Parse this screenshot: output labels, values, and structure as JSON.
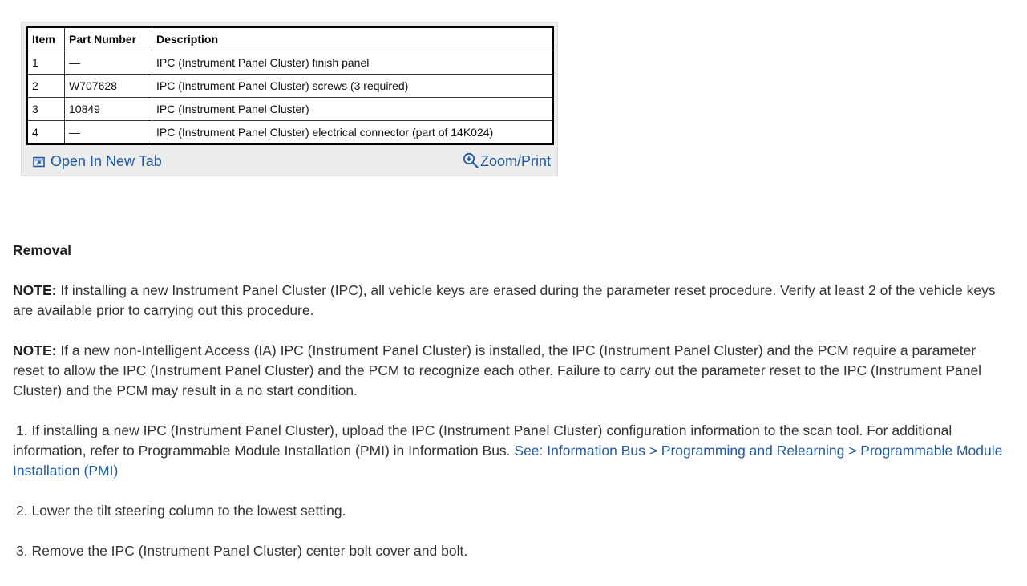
{
  "parts_table": {
    "headers": [
      "Item",
      "Part Number",
      "Description"
    ],
    "rows": [
      [
        "1",
        "—",
        "IPC (Instrument Panel Cluster) finish panel"
      ],
      [
        "2",
        "W707628",
        "IPC (Instrument Panel Cluster) screws (3 required)"
      ],
      [
        "3",
        "10849",
        "IPC (Instrument Panel Cluster)"
      ],
      [
        "4",
        "—",
        "IPC (Instrument Panel Cluster) electrical connector (part of 14K024)"
      ]
    ]
  },
  "figure_links": {
    "open_new_tab": "Open In New Tab",
    "open_new_tab_icon": "open-in-new-tab-icon",
    "zoom_print": "Zoom/Print",
    "zoom_print_icon": "zoom-in-icon"
  },
  "section": {
    "title": "Removal",
    "notes": [
      {
        "label": "NOTE:",
        "text": " If installing a new Instrument Panel Cluster (IPC), all vehicle keys are erased during the parameter reset procedure. Verify at least 2 of the vehicle keys are available prior to carrying out this procedure."
      },
      {
        "label": "NOTE:",
        "text": " If a new non-Intelligent Access (IA) IPC (Instrument Panel Cluster) is installed, the IPC (Instrument Panel Cluster) and the PCM require a parameter reset to allow the IPC (Instrument Panel Cluster) and the PCM to recognize each other. Failure to carry out the parameter reset to the IPC (Instrument Panel Cluster) and the PCM may result in a no start condition."
      }
    ],
    "steps": [
      {
        "number": "1.",
        "text": " If installing a new IPC (Instrument Panel Cluster), upload the IPC (Instrument Panel Cluster) configuration information to the scan tool. For additional information, refer to Programmable Module Installation (PMI) in Information Bus. ",
        "link": "See: Information Bus > Programming and Relearning > Programmable Module Installation (PMI)"
      },
      {
        "number": "2.",
        "text": " Lower the tilt steering column to the lowest setting."
      },
      {
        "number": "3.",
        "text": " Remove the IPC (Instrument Panel Cluster) center bolt cover and bolt."
      }
    ]
  },
  "colors": {
    "link": "#1f5aa6",
    "text": "#333333",
    "figure_background": "#ececec"
  }
}
